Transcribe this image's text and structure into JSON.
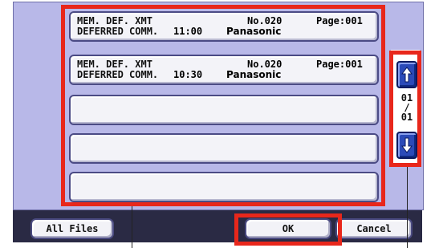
{
  "jobs": [
    {
      "mode": "MEM. DEF. XMT",
      "type": "DEFERRED COMM.",
      "time": "11:00",
      "number": "No.020",
      "page": "Page:001",
      "destination": "Panasonic"
    },
    {
      "mode": "MEM. DEF. XMT",
      "type": "DEFERRED COMM.",
      "time": "10:30",
      "number": "No.020",
      "page": "Page:001",
      "destination": "Panasonic"
    }
  ],
  "empty_slots": 3,
  "scroll": {
    "page_current": "01",
    "page_sep": "/",
    "page_total": "01",
    "up_icon": "arrow-up-icon",
    "down_icon": "arrow-down-icon"
  },
  "buttons": {
    "all_files": "All Files",
    "ok": "OK",
    "cancel": "Cancel"
  },
  "colors": {
    "highlight": "#e8271b",
    "panel": "#b8b8e8",
    "bar": "#2a2a44",
    "scroll_button": "#2b4ab8"
  }
}
